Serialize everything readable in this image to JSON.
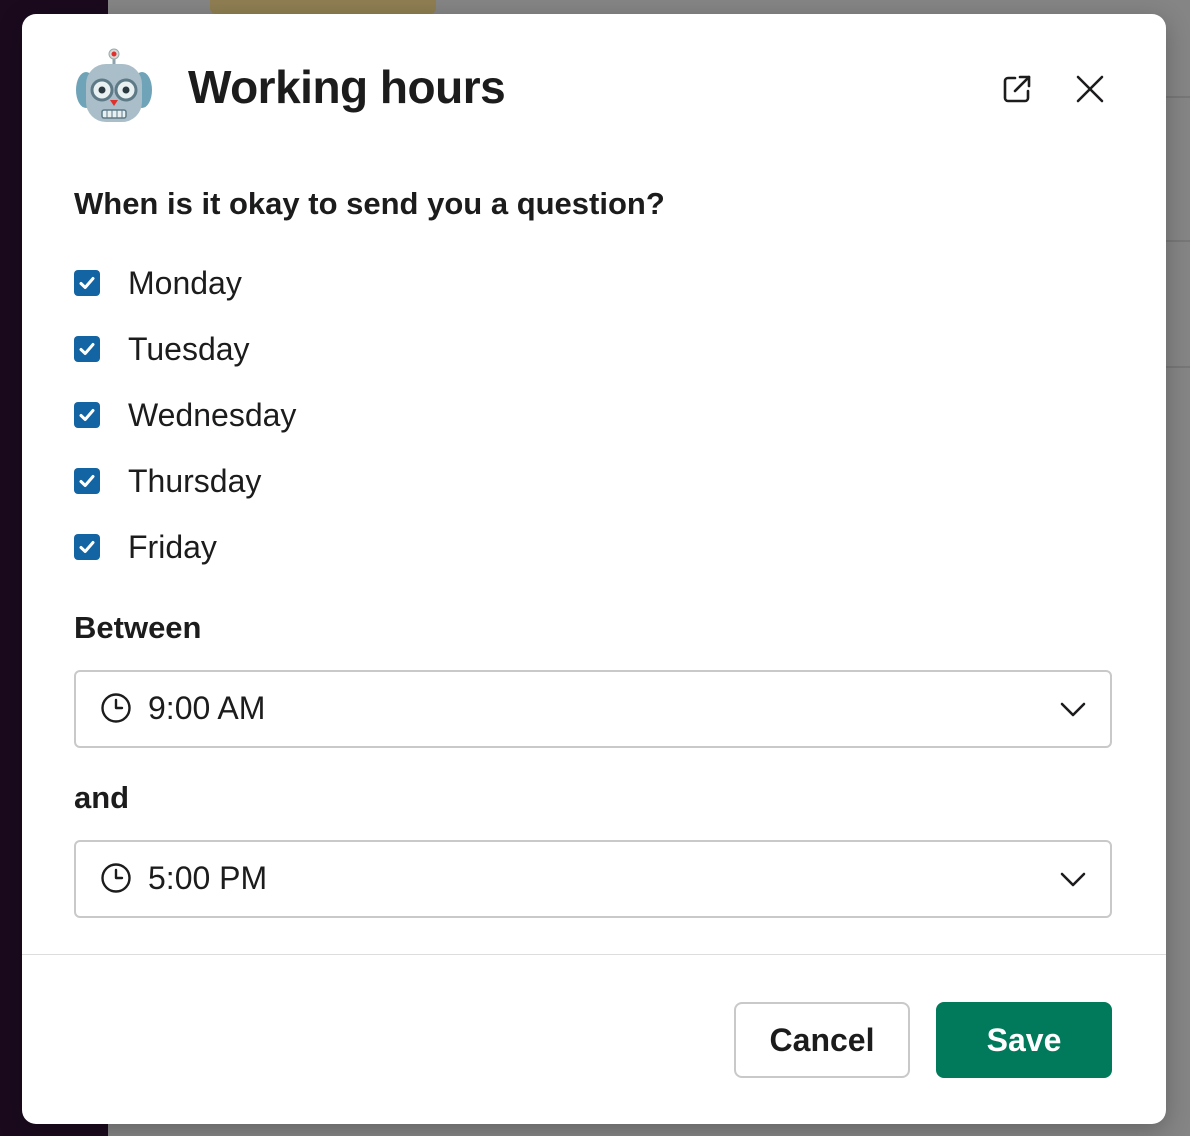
{
  "modal": {
    "title": "Working hours",
    "question": "When is it okay to send you a question?",
    "days": [
      {
        "label": "Monday",
        "checked": true
      },
      {
        "label": "Tuesday",
        "checked": true
      },
      {
        "label": "Wednesday",
        "checked": true
      },
      {
        "label": "Thursday",
        "checked": true
      },
      {
        "label": "Friday",
        "checked": true
      }
    ],
    "between_label": "Between",
    "start_time": "9:00 AM",
    "and_label": "and",
    "end_time": "5:00 PM",
    "cancel_label": "Cancel",
    "save_label": "Save"
  },
  "icons": {
    "app": "robot-icon",
    "open_in_window": "external-link-icon",
    "close": "close-icon",
    "checkbox": "checkmark-icon",
    "time": "clock-icon",
    "dropdown": "chevron-down-icon"
  },
  "colors": {
    "checkbox_accent": "#1264a3",
    "save_button": "#007a5a",
    "text": "#1d1c1d",
    "border": "#c9c9c9",
    "sidebar": "#1b0a1e"
  }
}
